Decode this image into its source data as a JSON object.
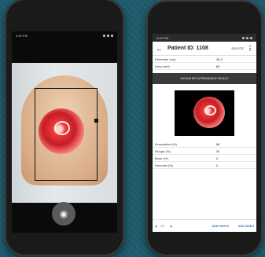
{
  "left_phone": {
    "status_time": "3:25 PM",
    "shutter_icon": "camera-icon"
  },
  "right_phone": {
    "status_time": "3:23 PM",
    "title": "Patient ID: 1108",
    "delete_label": "DELETE",
    "top_rows": [
      {
        "label": "Perimeter (cm)",
        "value": "35.3"
      },
      {
        "label": "Area (cm²)",
        "value": "80"
      }
    ],
    "section_title": "WOUND BED APPEARANCE RESULT",
    "result_rows": [
      {
        "label": "Granulation (%)",
        "value": "66"
      },
      {
        "label": "Slough (%)",
        "value": "34"
      },
      {
        "label": "Bone (%)",
        "value": "0"
      },
      {
        "label": "Necrosis (%)",
        "value": "0"
      }
    ],
    "pager": "1/3",
    "add_photo": "ADD PHOTO",
    "add_video": "ADD VIDEO"
  }
}
